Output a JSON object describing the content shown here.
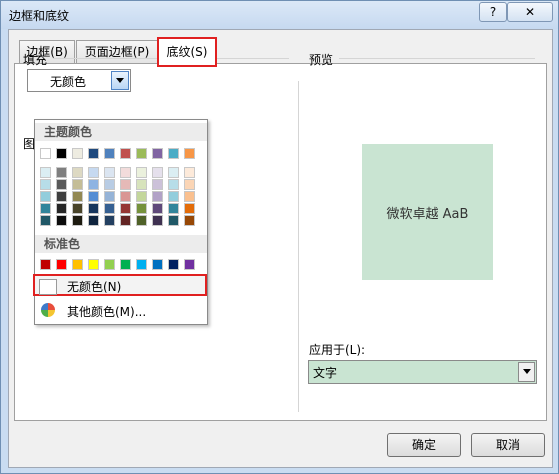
{
  "window": {
    "title": "边框和底纹",
    "help_label": "?",
    "close_label": "✕"
  },
  "tabs": [
    {
      "label": "边框(B)"
    },
    {
      "label": "页面边框(P)"
    },
    {
      "label": "底纹(S)",
      "active": true
    }
  ],
  "fill": {
    "label": "填充",
    "value": "无颜色"
  },
  "pattern": {
    "label_partial": "图"
  },
  "preview": {
    "label": "预览",
    "sample_text": "微软卓越  AaB",
    "sample_bg": "#c9e4d2"
  },
  "apply_to": {
    "label": "应用于(L):",
    "value": "文字"
  },
  "buttons": {
    "ok": "确定",
    "cancel": "取消"
  },
  "dropdown": {
    "theme_header": "主题颜色",
    "standard_header": "标准色",
    "no_color_label": "无颜色(N)",
    "more_colors_label": "其他颜色(M)...",
    "theme_colors": [
      [
        "#ffffff",
        "#000000",
        "#eeece1",
        "#1f497d",
        "#4f81bd",
        "#c0504d",
        "#9bbb59",
        "#8064a2",
        "#4bacc6",
        "#f79646"
      ],
      [
        "#dbeef3",
        "#7f7f7f",
        "#ddd9c3",
        "#c6d9f0",
        "#dbe5f1",
        "#f2dcdb",
        "#ebf1dd",
        "#e5e0ec",
        "#dbeef3",
        "#fdeada"
      ],
      [
        "#b7dde8",
        "#595959",
        "#c4bd97",
        "#8db3e2",
        "#b8cce4",
        "#e5b9b7",
        "#d7e3bc",
        "#ccc1d9",
        "#b7dde8",
        "#fbd5b5"
      ],
      [
        "#92cddc",
        "#3f3f3f",
        "#938953",
        "#548dd4",
        "#95b3d7",
        "#d99694",
        "#c3d69b",
        "#b2a2c7",
        "#92cddc",
        "#fac08f"
      ],
      [
        "#31859b",
        "#262626",
        "#494429",
        "#17365d",
        "#366092",
        "#953734",
        "#76923c",
        "#5f497a",
        "#31859b",
        "#e36c09"
      ],
      [
        "#205867",
        "#0c0c0c",
        "#1d1b10",
        "#0f243e",
        "#244061",
        "#632423",
        "#4f6128",
        "#3f3151",
        "#205867",
        "#974806"
      ]
    ],
    "standard_colors": [
      "#c00000",
      "#ff0000",
      "#ffc000",
      "#ffff00",
      "#92d050",
      "#00b050",
      "#00b0f0",
      "#0070c0",
      "#002060",
      "#7030a0"
    ]
  },
  "colors": {
    "accent_highlight": "#e02020",
    "title_bar": "#c9dcf1"
  }
}
